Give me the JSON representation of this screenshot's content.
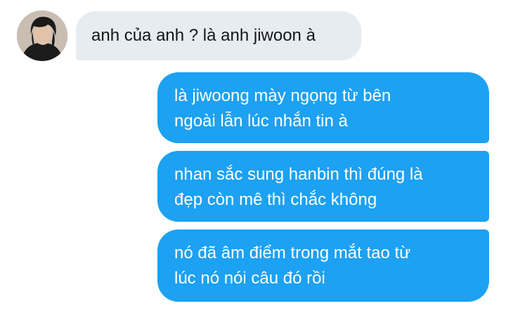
{
  "conversation": {
    "contact": {
      "avatar_icon": "profile-photo"
    },
    "messages": [
      {
        "direction": "incoming",
        "text": "anh của anh ? là anh jiwoon à"
      },
      {
        "direction": "outgoing",
        "line1": "là jiwoong mày ngọng từ bên",
        "line2": "ngoài lẫn lúc nhắn tin à"
      },
      {
        "direction": "outgoing",
        "line1": "nhan sắc sung hanbin thì đúng là",
        "line2": "đẹp còn mê thì chắc không"
      },
      {
        "direction": "outgoing",
        "line1": "nó đã âm điểm trong mắt tao từ",
        "line2": "lúc nó nói câu đó rồi"
      }
    ]
  },
  "colors": {
    "incoming_bubble": "#e6ecf0",
    "outgoing_bubble": "#1da1f2",
    "incoming_text": "#14171a",
    "outgoing_text": "#ffffff"
  }
}
